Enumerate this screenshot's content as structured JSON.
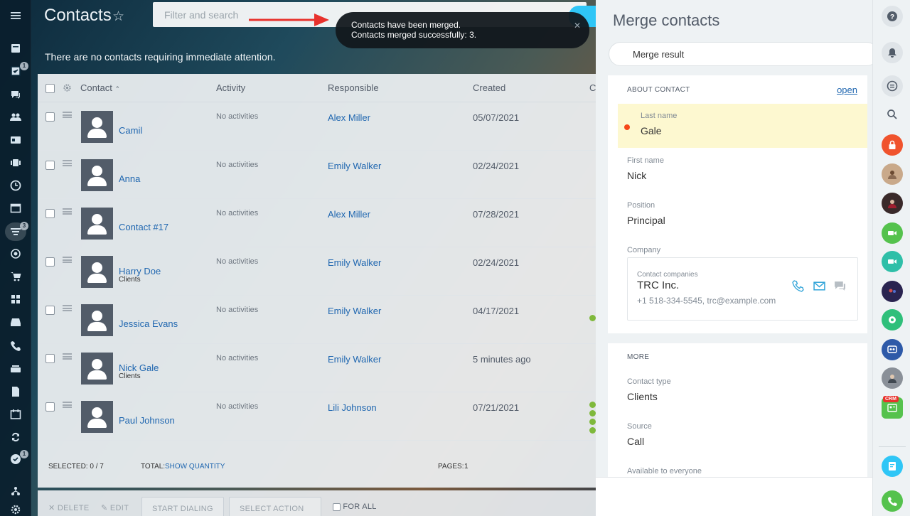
{
  "header": {
    "title": "Contacts",
    "search_placeholder": "Filter and search",
    "attention_text": "There are no contacts requiring immediate attention."
  },
  "toast": {
    "line1": "Contacts have been merged.",
    "line2": "Contacts merged successfully: 3."
  },
  "sidebar": {
    "badges": {
      "tasks": "1",
      "crm": "3",
      "bottom": "1"
    }
  },
  "grid": {
    "columns": {
      "contact": "Contact",
      "activity": "Activity",
      "responsible": "Responsible",
      "created": "Created",
      "extra": "C"
    },
    "rows": [
      {
        "name": "Camil",
        "sub": "",
        "activity": "No activities",
        "responsible": "Alex Miller",
        "created": "05/07/2021"
      },
      {
        "name": "Anna",
        "sub": "",
        "activity": "No activities",
        "responsible": "Emily Walker",
        "created": "02/24/2021"
      },
      {
        "name": "Contact #17",
        "sub": "",
        "activity": "No activities",
        "responsible": "Alex Miller",
        "created": "07/28/2021"
      },
      {
        "name": "Harry Doe",
        "sub": "Clients",
        "activity": "No activities",
        "responsible": "Emily Walker",
        "created": "02/24/2021"
      },
      {
        "name": "Jessica Evans",
        "sub": "",
        "activity": "No activities",
        "responsible": "Emily Walker",
        "created": "04/17/2021"
      },
      {
        "name": "Nick Gale",
        "sub": "Clients",
        "activity": "No activities",
        "responsible": "Emily Walker",
        "created": "5 minutes ago"
      },
      {
        "name": "Paul Johnson",
        "sub": "",
        "activity": "No activities",
        "responsible": "Lili Johnson",
        "created": "07/21/2021"
      }
    ],
    "footer": {
      "selected_label": "SELECTED: 0 / 7",
      "total_label": "TOTAL:",
      "show_quantity": "SHOW QUANTITY",
      "pages_label": "PAGES:",
      "pages_value": "1"
    }
  },
  "actions": {
    "delete": "DELETE",
    "edit": "EDIT",
    "start_dialing": "START DIALING",
    "select_action": "SELECT ACTION",
    "for_all": "FOR ALL"
  },
  "panel": {
    "title": "Merge contacts",
    "tab": "Merge result",
    "about_title": "ABOUT CONTACT",
    "open_link": "open",
    "fields": {
      "last_name_label": "Last name",
      "last_name": "Gale",
      "first_name_label": "First name",
      "first_name": "Nick",
      "position_label": "Position",
      "position": "Principal",
      "company_label": "Company"
    },
    "company": {
      "label": "Contact companies",
      "name": "TRC Inc.",
      "contact": "+1 518-334-5545, trc@example.com"
    },
    "more_title": "MORE",
    "more": {
      "contact_type_label": "Contact type",
      "contact_type": "Clients",
      "source_label": "Source",
      "source": "Call",
      "available_label": "Available to everyone"
    }
  },
  "rightbar": {
    "crm_label": "CRM"
  },
  "colors": {
    "link": "#2067b0",
    "accent": "#2fc6f6",
    "green": "#55d0e0",
    "highlight": "#fdf8d0",
    "alert_red": "#f54819"
  }
}
